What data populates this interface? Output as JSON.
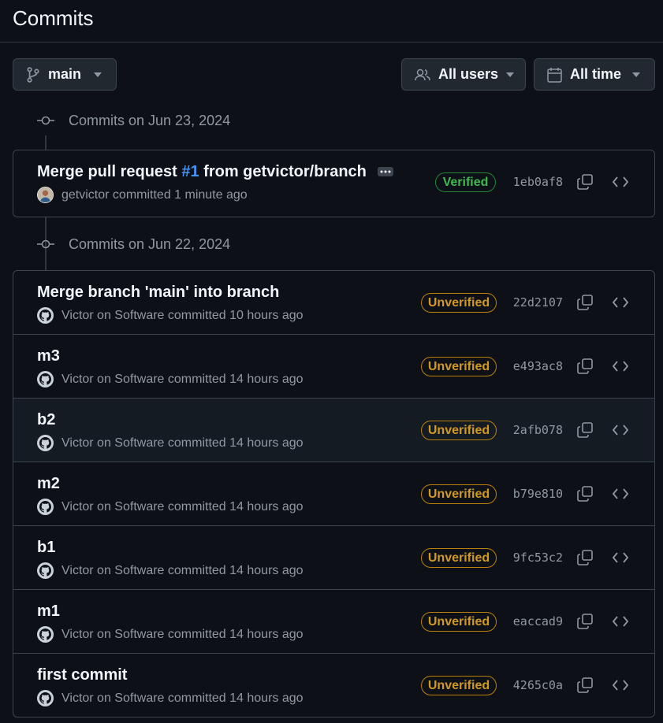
{
  "page": {
    "title": "Commits"
  },
  "toolbar": {
    "branch_label": "main",
    "users_label": "All users",
    "time_label": "All time"
  },
  "groups": [
    {
      "heading": "Commits on Jun 23, 2024",
      "commits": [
        {
          "title_prefix": "Merge pull request ",
          "pr_link": "#1",
          "title_suffix": " from getvictor/branch",
          "author": "getvictor",
          "meta_text": " committed 1 minute ago",
          "badge": "Verified",
          "sha": "1eb0af8"
        }
      ]
    },
    {
      "heading": "Commits on Jun 22, 2024",
      "commits": [
        {
          "title": "Merge branch 'main' into branch",
          "author": "Victor on Software",
          "meta_text": " committed 10 hours ago",
          "badge": "Unverified",
          "sha": "22d2107"
        },
        {
          "title": "m3",
          "author": "Victor on Software",
          "meta_text": " committed 14 hours ago",
          "badge": "Unverified",
          "sha": "e493ac8"
        },
        {
          "title": "b2",
          "author": "Victor on Software",
          "meta_text": " committed 14 hours ago",
          "badge": "Unverified",
          "sha": "2afb078"
        },
        {
          "title": "m2",
          "author": "Victor on Software",
          "meta_text": " committed 14 hours ago",
          "badge": "Unverified",
          "sha": "b79e810"
        },
        {
          "title": "b1",
          "author": "Victor on Software",
          "meta_text": " committed 14 hours ago",
          "badge": "Unverified",
          "sha": "9fc53c2"
        },
        {
          "title": "m1",
          "author": "Victor on Software",
          "meta_text": " committed 14 hours ago",
          "badge": "Unverified",
          "sha": "eaccad9"
        },
        {
          "title": "first commit",
          "author": "Victor on Software",
          "meta_text": " committed 14 hours ago",
          "badge": "Unverified",
          "sha": "4265c0a"
        }
      ]
    }
  ],
  "icons": {
    "branch": "git-branch-icon",
    "users": "people-icon",
    "calendar": "calendar-icon",
    "caret": "triangle-down-icon",
    "commit": "git-commit-icon",
    "copy": "copy-icon",
    "browse": "code-icon",
    "ellipsis": "kebab-horizontal-icon"
  },
  "colors": {
    "background": "#0d1117",
    "border": "#3d444d",
    "text": "#f0f6fc",
    "muted": "#9198a1",
    "link": "#4493f8",
    "verified": "#3fb950",
    "unverified": "#d29922"
  }
}
